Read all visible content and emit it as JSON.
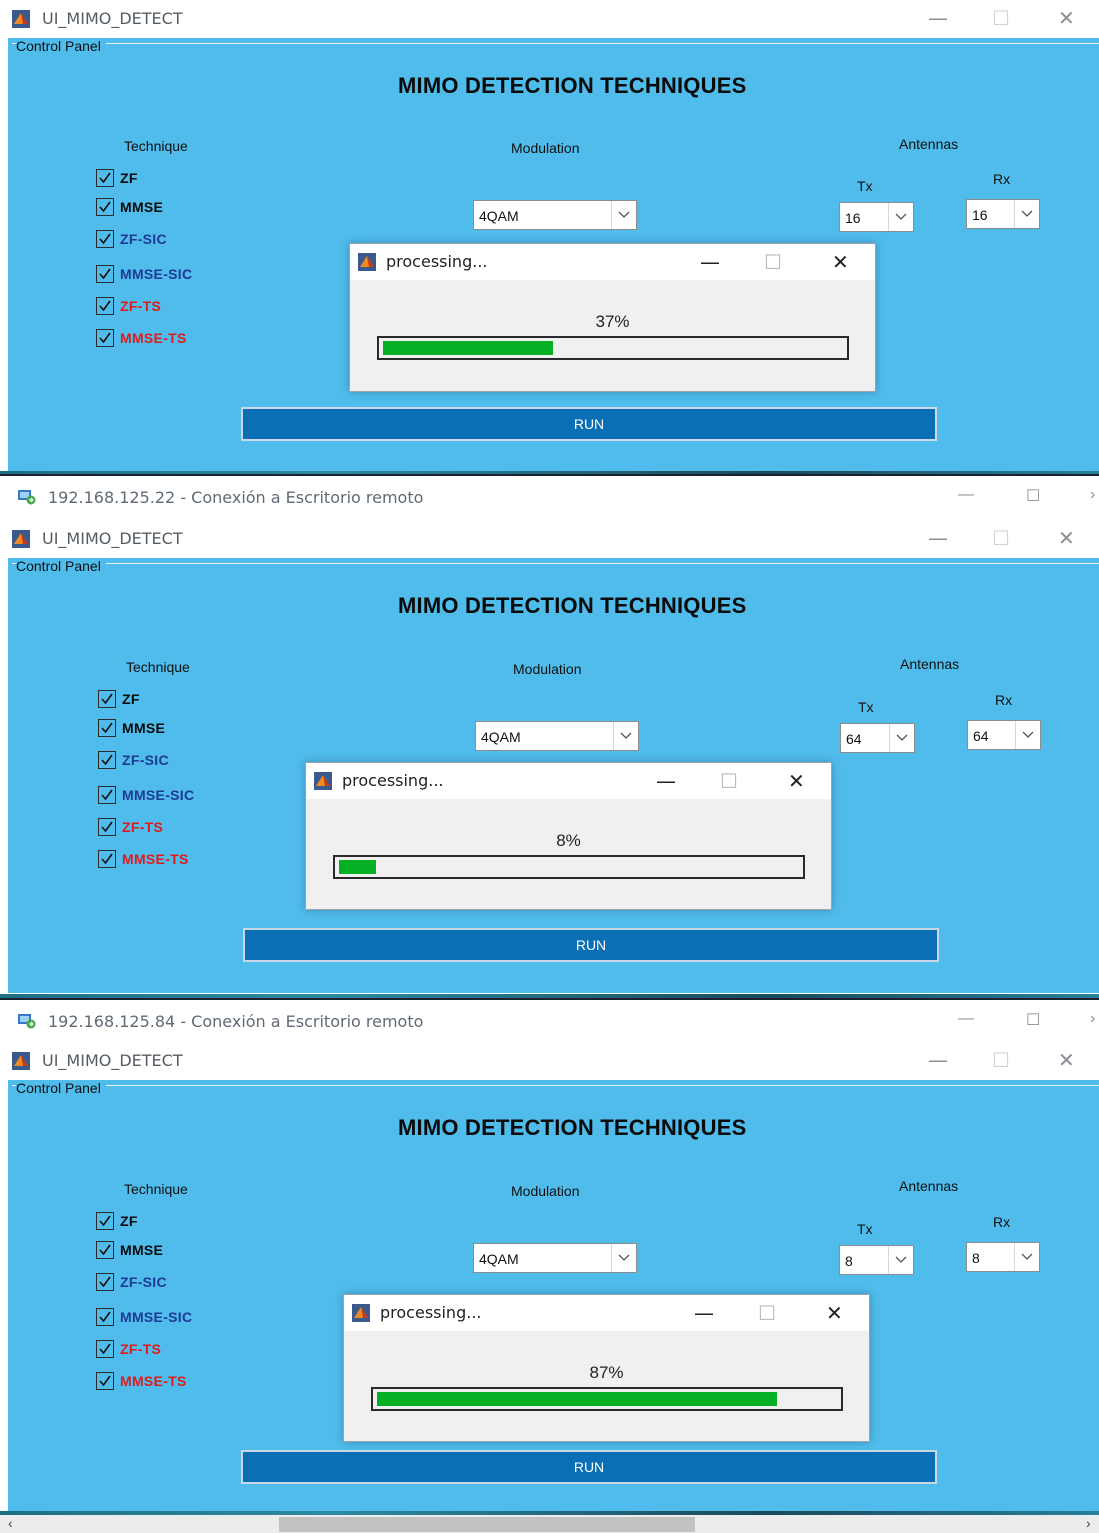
{
  "windows": [
    {
      "title": "UI_MIMO_DETECT",
      "panel_label": "Control Panel",
      "heading": "MIMO DETECTION TECHNIQUES",
      "technique_label": "Technique",
      "modulation_label": "Modulation",
      "antennas_label": "Antennas",
      "tx_label": "Tx",
      "rx_label": "Rx",
      "techniques": [
        {
          "label": "ZF",
          "checked": true,
          "color": "#0b0b0b"
        },
        {
          "label": "MMSE",
          "checked": true,
          "color": "#0b0b0b"
        },
        {
          "label": "ZF-SIC",
          "checked": true,
          "color": "#1f3a93"
        },
        {
          "label": "MMSE-SIC",
          "checked": true,
          "color": "#1f3a93"
        },
        {
          "label": "ZF-TS",
          "checked": true,
          "color": "#e11b1b"
        },
        {
          "label": "MMSE-TS",
          "checked": true,
          "color": "#e11b1b"
        }
      ],
      "modulation_value": "4QAM",
      "tx_value": "16",
      "rx_value": "16",
      "run_label": "RUN",
      "dialog": {
        "title": "processing...",
        "percent_text": "37%",
        "progress": 0.37
      }
    },
    {
      "title": "UI_MIMO_DETECT",
      "panel_label": "Control Panel",
      "heading": "MIMO DETECTION TECHNIQUES",
      "technique_label": "Technique",
      "modulation_label": "Modulation",
      "antennas_label": "Antennas",
      "tx_label": "Tx",
      "rx_label": "Rx",
      "techniques": [
        {
          "label": "ZF",
          "checked": true,
          "color": "#0b0b0b"
        },
        {
          "label": "MMSE",
          "checked": true,
          "color": "#0b0b0b"
        },
        {
          "label": "ZF-SIC",
          "checked": true,
          "color": "#1f3a93"
        },
        {
          "label": "MMSE-SIC",
          "checked": true,
          "color": "#1f3a93"
        },
        {
          "label": "ZF-TS",
          "checked": true,
          "color": "#e11b1b"
        },
        {
          "label": "MMSE-TS",
          "checked": true,
          "color": "#e11b1b"
        }
      ],
      "modulation_value": "4QAM",
      "tx_value": "64",
      "rx_value": "64",
      "run_label": "RUN",
      "dialog": {
        "title": "processing...",
        "percent_text": "8%",
        "progress": 0.08
      }
    },
    {
      "title": "UI_MIMO_DETECT",
      "panel_label": "Control Panel",
      "heading": "MIMO DETECTION TECHNIQUES",
      "technique_label": "Technique",
      "modulation_label": "Modulation",
      "antennas_label": "Antennas",
      "tx_label": "Tx",
      "rx_label": "Rx",
      "techniques": [
        {
          "label": "ZF",
          "checked": true,
          "color": "#0b0b0b"
        },
        {
          "label": "MMSE",
          "checked": true,
          "color": "#0b0b0b"
        },
        {
          "label": "ZF-SIC",
          "checked": true,
          "color": "#1f3a93"
        },
        {
          "label": "MMSE-SIC",
          "checked": true,
          "color": "#1f3a93"
        },
        {
          "label": "ZF-TS",
          "checked": true,
          "color": "#e11b1b"
        },
        {
          "label": "MMSE-TS",
          "checked": true,
          "color": "#e11b1b"
        }
      ],
      "modulation_value": "4QAM",
      "tx_value": "8",
      "rx_value": "8",
      "run_label": "RUN",
      "dialog": {
        "title": "processing...",
        "percent_text": "87%",
        "progress": 0.87
      }
    }
  ],
  "rdp_bars": [
    {
      "title": "192.168.125.22 - Conexión a Escritorio remoto"
    },
    {
      "title": "192.168.125.84 - Conexión a Escritorio remoto"
    }
  ],
  "colors": {
    "panel_bg": "#4fbcec",
    "run_button": "#0a6fb4",
    "progress_fill": "#06b025"
  },
  "icons": {
    "app_icon": "matlab-icon",
    "rdp_icon": "remote-desktop-icon",
    "minimize": "minimize-icon",
    "maximize": "maximize-icon",
    "close": "close-icon"
  }
}
